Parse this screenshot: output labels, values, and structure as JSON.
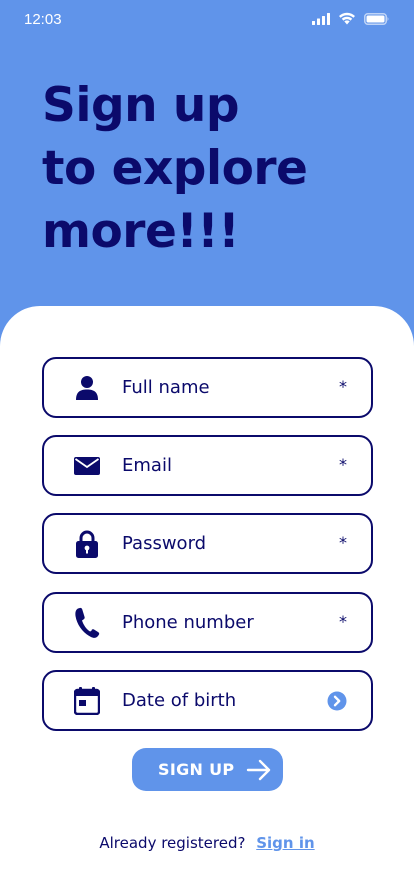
{
  "status_bar": {
    "time": "12:03",
    "icons": [
      "signal-icon",
      "wifi-icon",
      "battery-icon"
    ]
  },
  "hero": {
    "lines": [
      "Sign up",
      "to explore",
      "more!!!"
    ]
  },
  "form": {
    "fields": [
      {
        "label": "Full name",
        "icon": "user-icon",
        "required": "*"
      },
      {
        "label": "Email",
        "icon": "mail-icon",
        "required": "*"
      },
      {
        "label": "Password",
        "icon": "lock-icon",
        "required": "*"
      },
      {
        "label": "Phone number",
        "icon": "phone-icon",
        "required": "*"
      },
      {
        "label": "Date of birth",
        "icon": "calendar-icon",
        "trailing": "chevron-right-circle-icon"
      }
    ],
    "submit_label": "SIGN UP"
  },
  "footer": {
    "prompt": "Already registered?",
    "link": "Sign in"
  },
  "colors": {
    "primary": "#6094EA",
    "navy": "#0B0A6B",
    "surface": "#FFFFFF"
  }
}
